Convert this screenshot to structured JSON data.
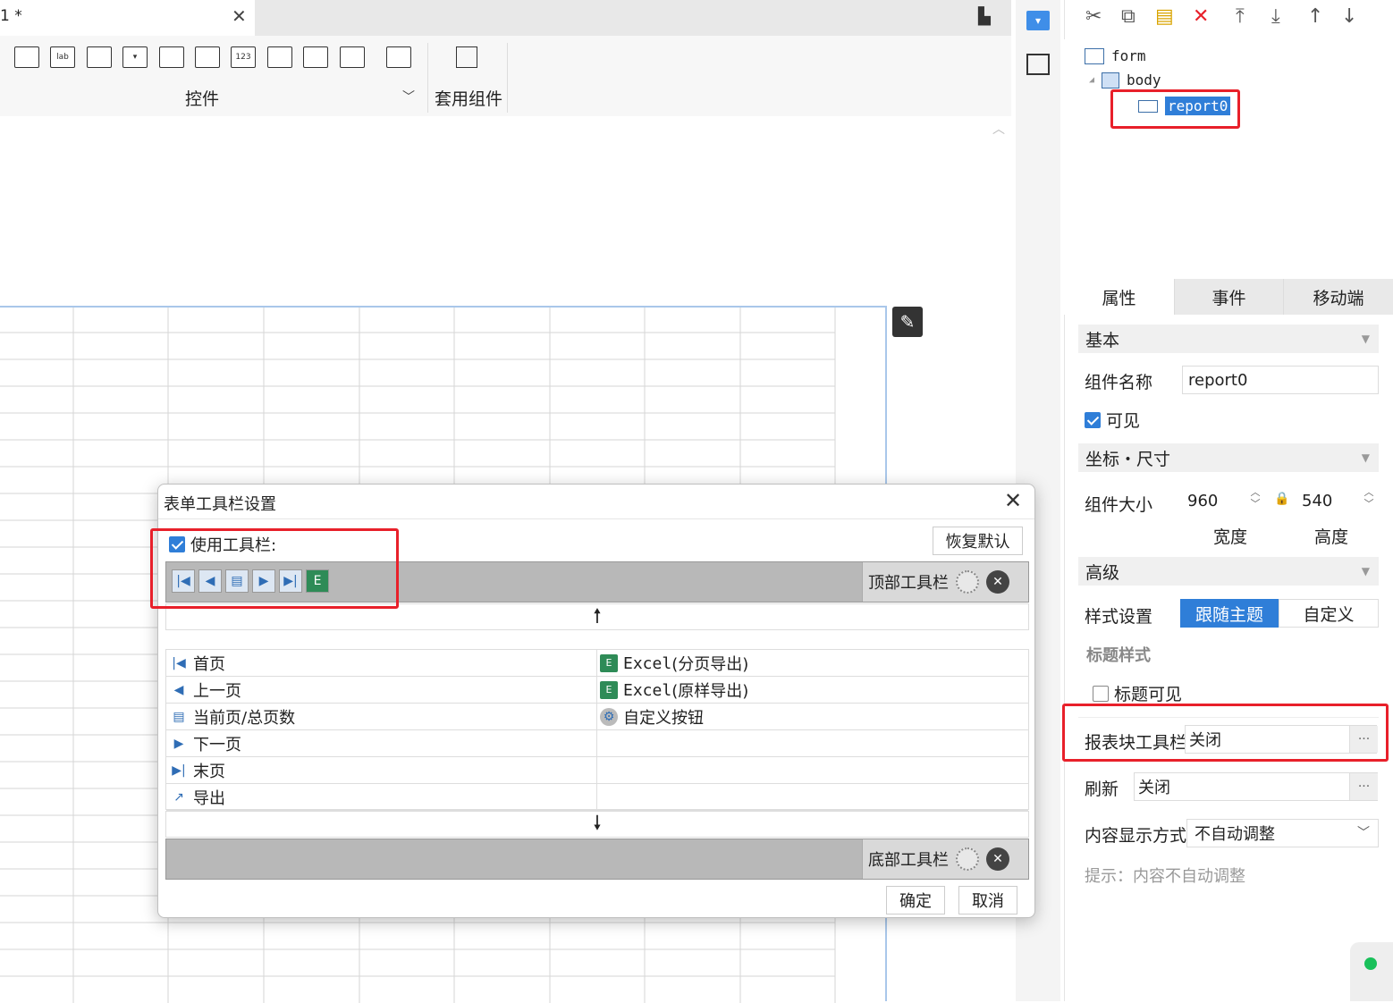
{
  "tab": {
    "title": "1 *",
    "close": "✕"
  },
  "ribbon": {
    "widget_icons": [
      "text-box-icon",
      "label-icon",
      "button-icon",
      "dropdown-icon",
      "date-icon",
      "calendar-icon",
      "number-icon",
      "textarea-icon",
      "radio-group-icon",
      "checkbox-group-icon",
      "search-icon"
    ],
    "widget_icon_texts": [
      "",
      "lab",
      "",
      "▾",
      "",
      "",
      "123",
      "",
      "",
      "",
      ""
    ],
    "controls_label": "控件",
    "apply_components_label": "套用组件"
  },
  "tree": {
    "form": "form",
    "body": "body",
    "report": "report0"
  },
  "prop_tabs": {
    "attributes": "属性",
    "events": "事件",
    "mobile": "移动端"
  },
  "props": {
    "basic": "基本",
    "name_label": "组件名称",
    "name_value": "report0",
    "visible_label": "可见",
    "coords_size": "坐标・尺寸",
    "size_label": "组件大小",
    "width_value": "960",
    "height_value": "540",
    "width_label": "宽度",
    "height_label": "高度",
    "advanced": "高级",
    "style_label": "样式设置",
    "follow_theme": "跟随主题",
    "custom": "自定义",
    "title_style": "标题样式",
    "title_visible": "标题可见",
    "report_toolbar_label": "报表块工具栏",
    "report_toolbar_value": "关闭",
    "refresh_label": "刷新",
    "refresh_value": "关闭",
    "content_display_label": "内容显示方式",
    "content_display_value": "不自动调整",
    "hint": "提示：内容不自动调整"
  },
  "dialog": {
    "title": "表单工具栏设置",
    "use_toolbar": "使用工具栏:",
    "restore_default": "恢复默认",
    "top_toolbar": "顶部工具栏",
    "bottom_toolbar": "底部工具栏",
    "left_items": [
      "首页",
      "上一页",
      "当前页/总页数",
      "下一页",
      "末页",
      "导出"
    ],
    "right_items_prefix": [
      "Excel",
      "Excel",
      ""
    ],
    "right_items": [
      "(分页导出)",
      "(原样导出)",
      "自定义按钮"
    ],
    "ok": "确定",
    "cancel": "取消"
  },
  "colors": {
    "accent": "#2f7ed8",
    "highlight": "#e8202a",
    "toolbar_gray": "#b8b8b8"
  }
}
